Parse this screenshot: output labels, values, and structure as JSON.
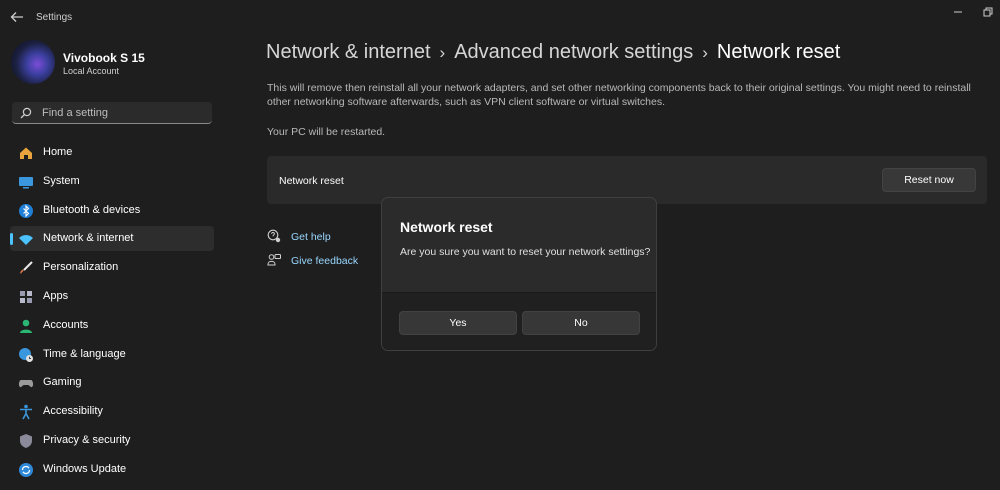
{
  "app": {
    "title": "Settings"
  },
  "profile": {
    "name": "Vivobook S 15",
    "account_type": "Local Account"
  },
  "search": {
    "placeholder": "Find a setting"
  },
  "sidebar": {
    "items": [
      {
        "label": "Home",
        "icon": "home-icon",
        "color": "#e8a33c"
      },
      {
        "label": "System",
        "icon": "monitor-icon",
        "color": "#3a96dd"
      },
      {
        "label": "Bluetooth & devices",
        "icon": "bluetooth-icon",
        "color": "#1f7ed6"
      },
      {
        "label": "Network & internet",
        "icon": "wifi-icon",
        "color": "#4cc2ff",
        "active": true
      },
      {
        "label": "Personalization",
        "icon": "paintbrush-icon",
        "color": "#e8814a"
      },
      {
        "label": "Apps",
        "icon": "apps-icon",
        "color": "#9a9ab0"
      },
      {
        "label": "Accounts",
        "icon": "person-icon",
        "color": "#2bb673"
      },
      {
        "label": "Time & language",
        "icon": "globe-clock-icon",
        "color": "#3a96dd"
      },
      {
        "label": "Gaming",
        "icon": "gamepad-icon",
        "color": "#9a9a9a"
      },
      {
        "label": "Accessibility",
        "icon": "accessibility-icon",
        "color": "#3a96dd"
      },
      {
        "label": "Privacy & security",
        "icon": "shield-icon",
        "color": "#8a8a9a"
      },
      {
        "label": "Windows Update",
        "icon": "update-icon",
        "color": "#2f89d9"
      }
    ]
  },
  "breadcrumb": {
    "items": [
      "Network & internet",
      "Advanced network settings",
      "Network reset"
    ],
    "separator": "›"
  },
  "main": {
    "description": "This will remove then reinstall all your network adapters, and set other networking components back to their original settings. You might need to reinstall other networking software afterwards, such as VPN client software or virtual switches.",
    "restart_note": "Your PC will be restarted.",
    "card": {
      "label": "Network reset",
      "button": "Reset now"
    },
    "links": [
      {
        "label": "Get help",
        "icon": "help-icon"
      },
      {
        "label": "Give feedback",
        "icon": "feedback-icon"
      }
    ]
  },
  "dialog": {
    "title": "Network reset",
    "message": "Are you sure you want to reset your network settings?",
    "yes_label": "Yes",
    "no_label": "No"
  },
  "colors": {
    "accent": "#4cc2ff",
    "background": "#1e1e1e",
    "link": "#99d7ff"
  }
}
